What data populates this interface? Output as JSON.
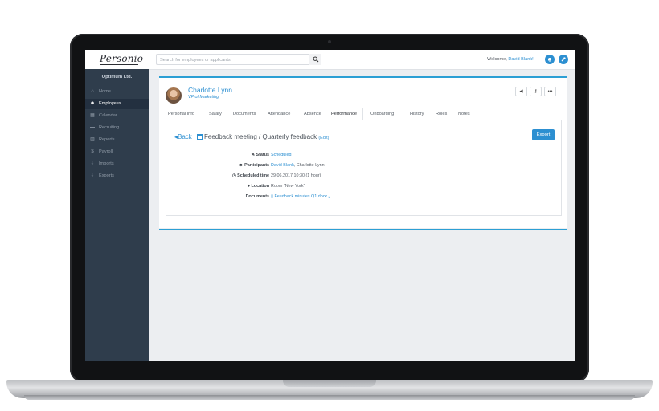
{
  "colors": {
    "accent": "#2c8fd1",
    "sidebar_bg": "#2f3d4c",
    "strip": "#2c9fd4"
  },
  "topbar": {
    "logo": "Personio",
    "search_placeholder": "Search for employees or applicants",
    "welcome_prefix": "Welcome, ",
    "welcome_user": "David Blank!"
  },
  "sidebar": {
    "company": "Optimum Ltd.",
    "items": [
      {
        "label": "Home",
        "icon": "home-icon",
        "glyph": "⌂"
      },
      {
        "label": "Employees",
        "icon": "users-icon",
        "glyph": "☻"
      },
      {
        "label": "Calendar",
        "icon": "calendar-icon",
        "glyph": "▦"
      },
      {
        "label": "Recruiting",
        "icon": "briefcase-icon",
        "glyph": "▬"
      },
      {
        "label": "Reports",
        "icon": "chart-icon",
        "glyph": "▥"
      },
      {
        "label": "Payroll",
        "icon": "dollar-icon",
        "glyph": "$"
      },
      {
        "label": "Imports",
        "icon": "download-icon",
        "glyph": "⤓"
      },
      {
        "label": "Exports",
        "icon": "download-icon",
        "glyph": "⤓"
      }
    ],
    "active_index": 1
  },
  "employee": {
    "name": "Charlotte Lynn",
    "role": "VP of Marketing"
  },
  "actions": [
    {
      "icon": "megaphone-icon",
      "glyph": "◀"
    },
    {
      "icon": "key-icon",
      "glyph": "⚷"
    },
    {
      "icon": "more-icon",
      "glyph": "•••"
    }
  ],
  "tabs": [
    "Personal Info",
    "Salary",
    "Documents",
    "Attendance",
    "Absence",
    "Performance",
    "Onboarding",
    "History",
    "Roles",
    "Notes"
  ],
  "active_tab": "Performance",
  "detail": {
    "back_label": "Back",
    "title": "Feedback meeting / Quarterly feedback",
    "edit_label": "Edit",
    "export_label": "Export",
    "rows": [
      {
        "key": "Status",
        "icon": "tag-icon",
        "glyph": "✎",
        "value": "Scheduled",
        "link": true
      },
      {
        "key": "Participants",
        "icon": "users-icon",
        "glyph": "☻",
        "value_link": "David Blank",
        "value_rest": ", Charlotte Lynn"
      },
      {
        "key": "Scheduled time",
        "icon": "clock-icon",
        "glyph": "◷",
        "value": "29.06.2017 10:30 (1 hour)"
      },
      {
        "key": "Location",
        "icon": "pin-icon",
        "glyph": "♦",
        "value": "Room \"New York\""
      },
      {
        "key": "Documents",
        "icon": "file-icon",
        "glyph": "",
        "value": "Feedback minutes Q1.docx",
        "link": true
      }
    ]
  }
}
